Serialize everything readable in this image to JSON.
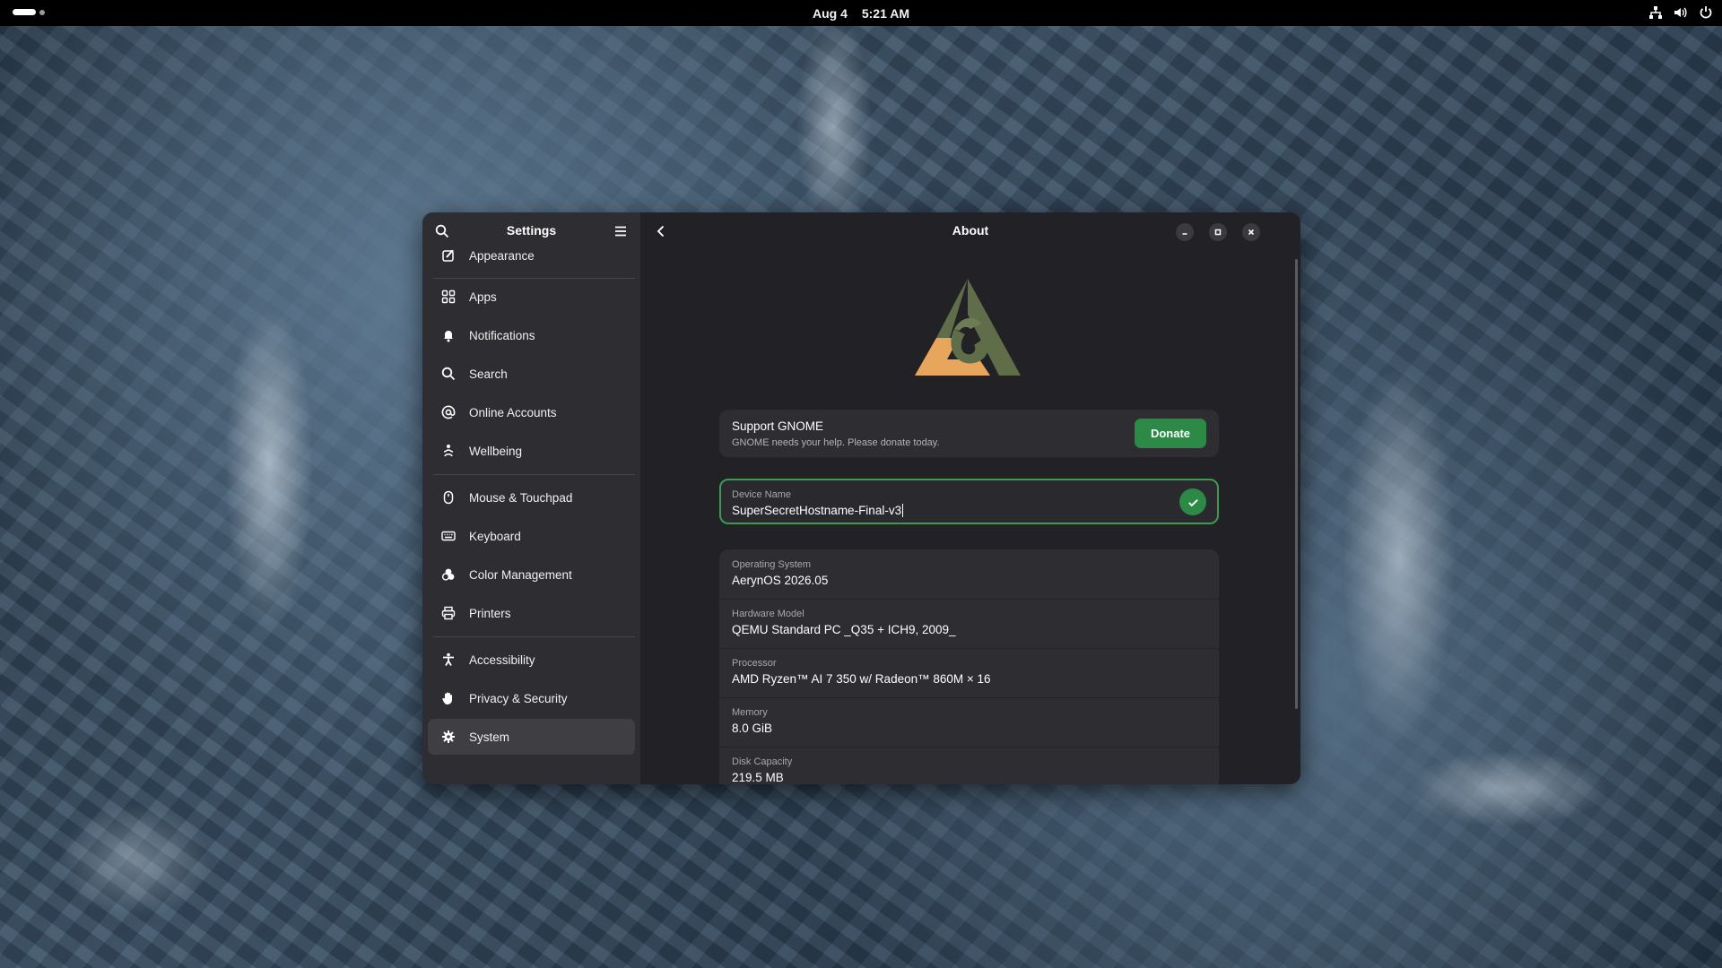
{
  "topbar": {
    "date": "Aug 4",
    "time": "5:21 AM",
    "tray_icons": [
      "network-icon",
      "volume-icon",
      "power-icon"
    ]
  },
  "sidebar": {
    "title": "Settings",
    "items": [
      {
        "label": "Appearance",
        "icon": "appearance-icon"
      },
      {
        "label": "Apps",
        "icon": "apps-grid-icon"
      },
      {
        "label": "Notifications",
        "icon": "bell-icon"
      },
      {
        "label": "Search",
        "icon": "search-icon"
      },
      {
        "label": "Online Accounts",
        "icon": "at-sign-icon"
      },
      {
        "label": "Wellbeing",
        "icon": "wellbeing-icon"
      },
      {
        "label": "Mouse & Touchpad",
        "icon": "mouse-icon"
      },
      {
        "label": "Keyboard",
        "icon": "keyboard-icon"
      },
      {
        "label": "Color Management",
        "icon": "color-icon"
      },
      {
        "label": "Printers",
        "icon": "printer-icon"
      },
      {
        "label": "Accessibility",
        "icon": "accessibility-icon"
      },
      {
        "label": "Privacy & Security",
        "icon": "hand-icon"
      },
      {
        "label": "System",
        "icon": "gear-icon",
        "active": true
      }
    ]
  },
  "content": {
    "title": "About",
    "support": {
      "title": "Support GNOME",
      "subtitle": "GNOME needs your help. Please donate today.",
      "button": "Donate"
    },
    "device": {
      "label": "Device Name",
      "value": "SuperSecretHostname-Final-v3"
    },
    "info": [
      {
        "label": "Operating System",
        "value": "AerynOS 2026.05"
      },
      {
        "label": "Hardware Model",
        "value": "QEMU Standard PC _Q35 + ICH9, 2009_"
      },
      {
        "label": "Processor",
        "value": "AMD Ryzen™ AI 7 350 w/ Radeon™ 860M × 16"
      },
      {
        "label": "Memory",
        "value": "8.0 GiB"
      },
      {
        "label": "Disk Capacity",
        "value": "219.5 MB"
      }
    ]
  },
  "colors": {
    "accent": "#2c8a46",
    "logo_orange": "#e8a55c",
    "logo_green": "#5f6e49"
  }
}
